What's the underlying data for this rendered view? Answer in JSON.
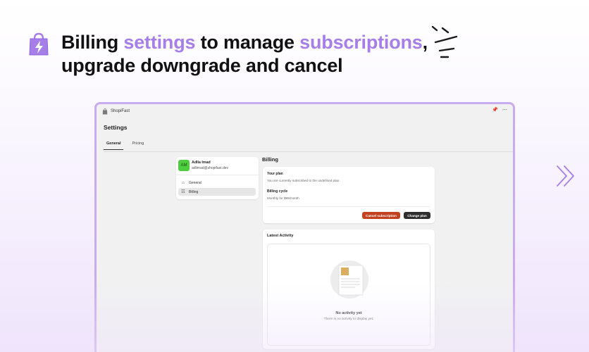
{
  "hero": {
    "headline_part1": "Billing ",
    "headline_accent1": "settings",
    "headline_part2": " to manage ",
    "headline_accent2": "subscriptions",
    "headline_part3": ",",
    "headline_line2": "upgrade downgrade and cancel",
    "accent_color": "#a57ee8",
    "logo_icon": "shopping-bag-lightning-icon"
  },
  "window": {
    "app_name": "ShopiFast",
    "titlebar_icons": [
      "pin-icon",
      "more-icon"
    ]
  },
  "settings": {
    "title": "Settings",
    "tabs": [
      {
        "label": "General",
        "active": true
      },
      {
        "label": "Pricing",
        "active": false
      }
    ]
  },
  "profile": {
    "initials": "AM",
    "name": "Adlla Imad",
    "email": "adlimad@shopifast.dev",
    "avatar_color": "#4ece3e"
  },
  "nav": {
    "items": [
      {
        "label": "General",
        "icon": "home-icon",
        "selected": false
      },
      {
        "label": "Billing",
        "icon": "receipt-icon",
        "selected": true
      }
    ]
  },
  "billing": {
    "title": "Billing",
    "plan_label": "Your plan",
    "plan_text": "You are currently subscribed to the undefined plan.",
    "cycle_label": "Billing cycle",
    "cycle_text": "Monthly for $99/month",
    "cancel_button": "Cancel subscription",
    "change_button": "Change plan",
    "cancel_color": "#c2411f"
  },
  "activity": {
    "title": "Latest Activity",
    "empty_title": "No activity yet",
    "empty_desc": "There is no activity to display yet."
  }
}
